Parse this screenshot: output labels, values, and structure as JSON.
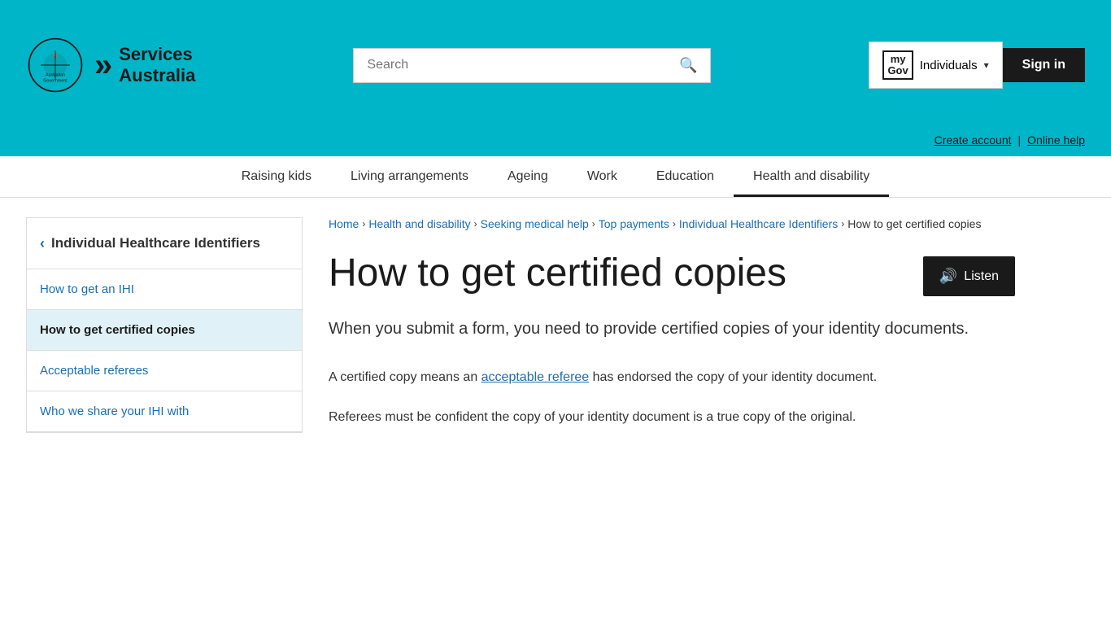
{
  "header": {
    "site_title": "Services Australia",
    "site_subtitle_line1": "Services",
    "site_subtitle_line2": "Australia",
    "gov_label": "Australian Government",
    "search_placeholder": "Search",
    "mygov_label": "my\nGov",
    "individuals_label": "Individuals",
    "signin_label": "Sign in",
    "create_account_label": "Create account",
    "online_help_label": "Online help"
  },
  "nav": {
    "items": [
      {
        "label": "Raising kids",
        "active": false
      },
      {
        "label": "Living arrangements",
        "active": false
      },
      {
        "label": "Ageing",
        "active": false
      },
      {
        "label": "Work",
        "active": false
      },
      {
        "label": "Education",
        "active": false
      },
      {
        "label": "Health and disability",
        "active": true
      }
    ]
  },
  "sidebar": {
    "title": "Individual Healthcare Identifiers",
    "back_label": "‹",
    "items": [
      {
        "label": "How to get an IHI",
        "active": false
      },
      {
        "label": "How to get certified copies",
        "active": true
      },
      {
        "label": "Acceptable referees",
        "active": false
      },
      {
        "label": "Who we share your IHI with",
        "active": false
      }
    ]
  },
  "breadcrumb": {
    "items": [
      {
        "label": "Home"
      },
      {
        "label": "Health and disability"
      },
      {
        "label": "Seeking medical help"
      },
      {
        "label": "Top payments"
      },
      {
        "label": "Individual Healthcare Identifiers"
      },
      {
        "label": "How to get certified copies"
      }
    ]
  },
  "main": {
    "page_title": "How to get certified copies",
    "listen_label": "Listen",
    "intro": "When you submit a form, you need to provide certified copies of your identity documents.",
    "para1_prefix": "A certified copy means an ",
    "para1_link": "acceptable referee",
    "para1_suffix": " has endorsed the copy of your identity document.",
    "para2": "Referees must be confident the copy of your identity document is a true copy of the original."
  }
}
